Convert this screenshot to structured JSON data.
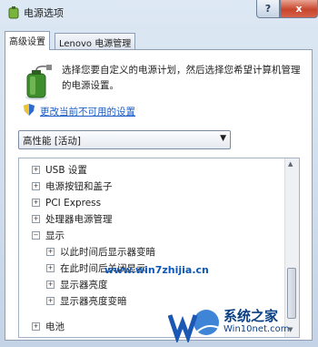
{
  "window": {
    "title": "电源选项",
    "help": "?",
    "close": "x"
  },
  "tabs": [
    {
      "label": "高级设置"
    },
    {
      "label": "Lenovo 电源管理"
    }
  ],
  "description": "选择您要自定义的电源计划，然后选择您希望计算机管理的电源设置。",
  "change_link": "更改当前不可用的设置",
  "plan_select": {
    "value": "高性能 [活动]"
  },
  "tree": [
    {
      "label": "USB 设置",
      "expander": "+"
    },
    {
      "label": "电源按钮和盖子",
      "expander": "+"
    },
    {
      "label": "PCI Express",
      "expander": "+"
    },
    {
      "label": "处理器电源管理",
      "expander": "+"
    },
    {
      "label": "显示",
      "expander": "−"
    },
    {
      "label": "以此时间后显示器变暗",
      "expander": "+"
    },
    {
      "label": "在此时间后关闭显示",
      "expander": "+"
    },
    {
      "label": "显示器亮度",
      "expander": "+"
    },
    {
      "label": "显示器亮度变暗",
      "expander": "+"
    },
    {
      "label": "电池",
      "expander": "+"
    }
  ],
  "watermark": {
    "url": "www.win7zhijia.cn",
    "brand": "系统之家",
    "site": "Win10net.com"
  }
}
